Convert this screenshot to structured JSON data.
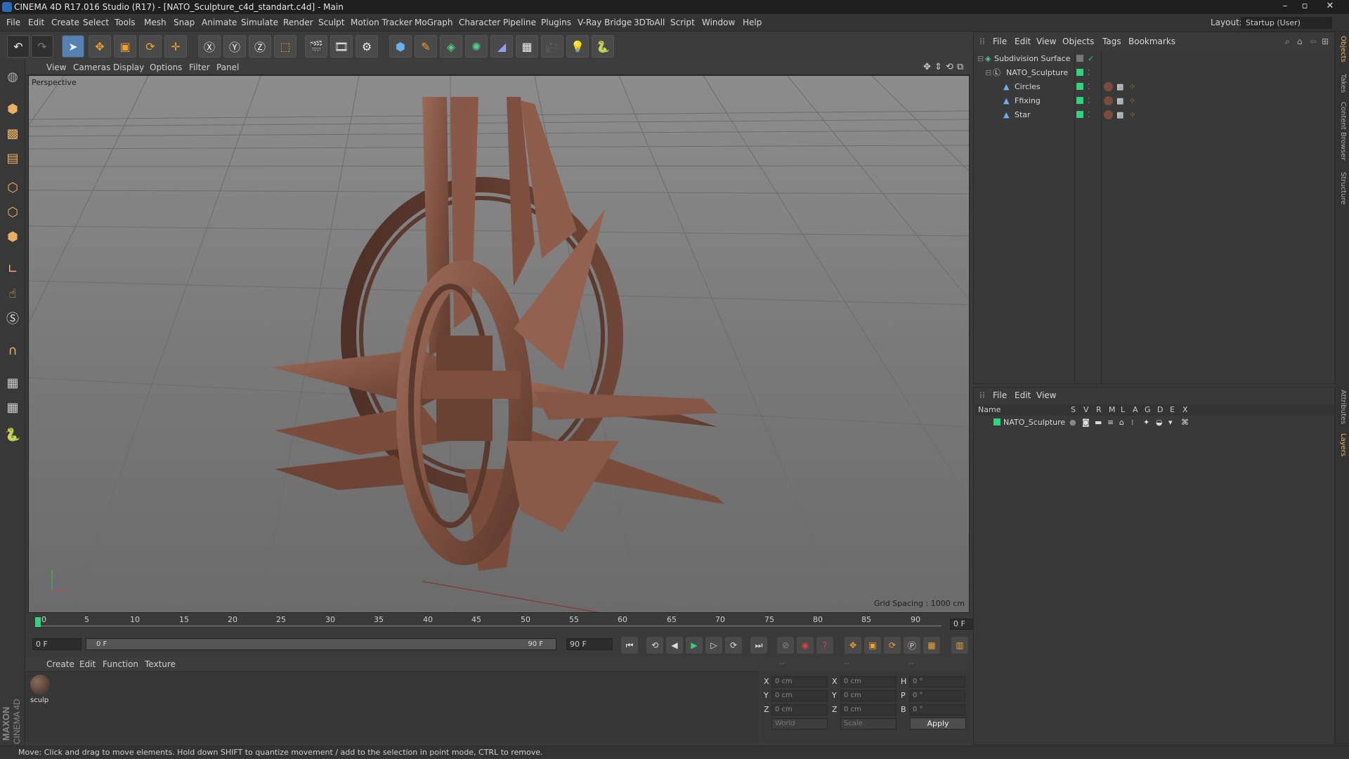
{
  "window": {
    "title": "CINEMA 4D R17.016 Studio (R17) - [NATO_Sculpture_c4d_standart.c4d] - Main"
  },
  "menubar": {
    "items": [
      "File",
      "Edit",
      "Create",
      "Select",
      "Tools",
      "Mesh",
      "Snap",
      "Animate",
      "Simulate",
      "Render",
      "Sculpt",
      "Motion Tracker",
      "MoGraph",
      "Character",
      "Pipeline",
      "Plugins",
      "V-Ray Bridge",
      "3DToAll",
      "Script",
      "Window",
      "Help"
    ],
    "layout_label": "Layout:",
    "layout_value": "Startup (User)"
  },
  "viewport": {
    "menu": [
      "View",
      "Cameras",
      "Display",
      "Options",
      "Filter",
      "Panel"
    ],
    "camera_label": "Perspective",
    "grid_spacing": "Grid Spacing : 1000 cm"
  },
  "timeline": {
    "ticks": [
      "0",
      "5",
      "10",
      "15",
      "20",
      "25",
      "30",
      "35",
      "40",
      "45",
      "50",
      "55",
      "60",
      "65",
      "70",
      "75",
      "80",
      "85",
      "90"
    ],
    "current_frame": "0 F"
  },
  "transport": {
    "start_frame": "0 F",
    "range_start": "0 F",
    "range_end": "90 F",
    "end_frame": "90 F"
  },
  "materials": {
    "menu": [
      "Create",
      "Edit",
      "Function",
      "Texture"
    ],
    "items": [
      {
        "label": "sculp"
      }
    ]
  },
  "coordinates": {
    "header": [
      "--",
      "--",
      "--"
    ],
    "rows": [
      {
        "a_label": "X",
        "a_value": "0 cm",
        "b_label": "X",
        "b_value": "0 cm",
        "c_label": "H",
        "c_value": "0 °"
      },
      {
        "a_label": "Y",
        "a_value": "0 cm",
        "b_label": "Y",
        "b_value": "0 cm",
        "c_label": "P",
        "c_value": "0 °"
      },
      {
        "a_label": "Z",
        "a_value": "0 cm",
        "b_label": "Z",
        "b_value": "0 cm",
        "c_label": "B",
        "c_value": "0 °"
      }
    ],
    "space_select": "World",
    "mode_select": "Scale",
    "apply_label": "Apply"
  },
  "objects_panel": {
    "menu": [
      "File",
      "Edit",
      "View",
      "Objects",
      "Tags",
      "Bookmarks"
    ],
    "tree": [
      {
        "name": "Subdivision Surface",
        "indent": 0
      },
      {
        "name": "NATO_Sculpture",
        "indent": 1
      },
      {
        "name": "Circles",
        "indent": 2
      },
      {
        "name": "Ffixing",
        "indent": 2
      },
      {
        "name": "Star",
        "indent": 2
      }
    ]
  },
  "layers_panel": {
    "menu": [
      "File",
      "Edit",
      "View"
    ],
    "columns": [
      "Name",
      "S",
      "V",
      "R",
      "M",
      "L",
      "A",
      "G",
      "D",
      "E",
      "X"
    ],
    "rows": [
      {
        "name": "NATO_Sculpture"
      }
    ]
  },
  "side_tabs": [
    "Objects",
    "Takes",
    "Content Browser",
    "Structure",
    "Attributes",
    "Layers"
  ],
  "status": {
    "text": "Move: Click and drag to move elements. Hold down SHIFT to quantize movement / add to the selection in point mode, CTRL to remove."
  },
  "colors": {
    "accent": "#5480b4",
    "layer_green": "#2fd47c",
    "sculpture": "#8a5a48"
  },
  "logo": {
    "text": "MAXON CINEMA 4D"
  }
}
